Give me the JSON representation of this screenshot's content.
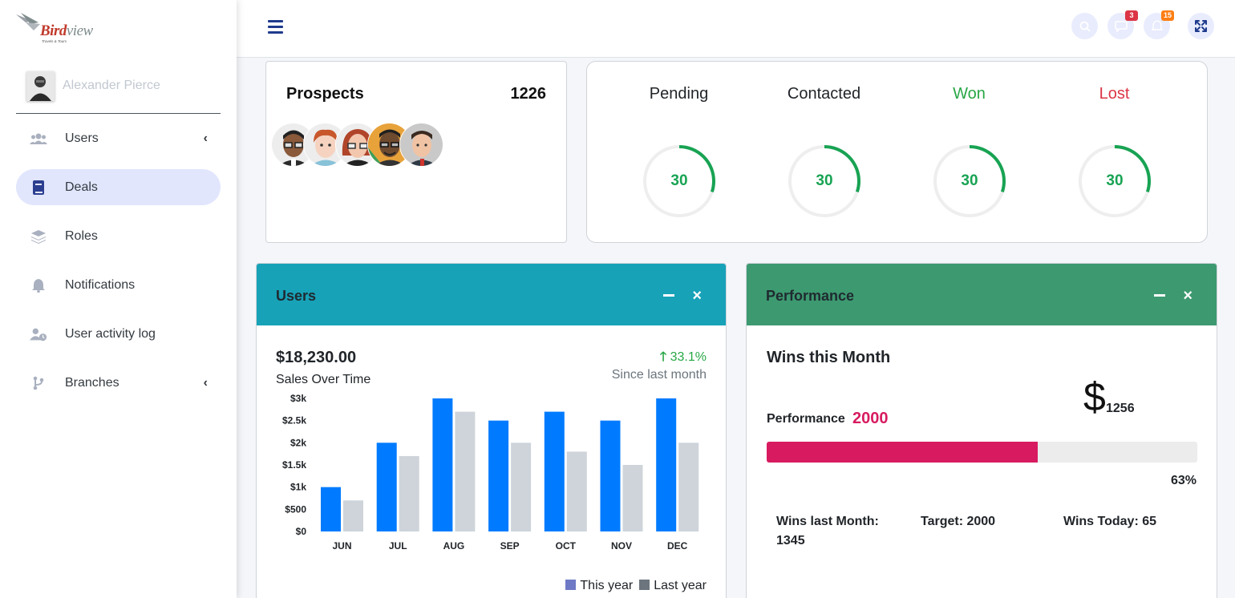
{
  "brand": {
    "name_a": "Bird",
    "name_b": "view",
    "tagline": "Travels & Tours"
  },
  "user": {
    "name": "Alexander Pierce"
  },
  "sidebar": {
    "items": [
      {
        "label": "Users",
        "icon": "users-icon",
        "has_caret": true
      },
      {
        "label": "Deals",
        "icon": "book-icon",
        "active": true
      },
      {
        "label": "Roles",
        "icon": "layers-icon"
      },
      {
        "label": "Notifications",
        "icon": "bell-icon"
      },
      {
        "label": "User activity log",
        "icon": "user-clock-icon"
      },
      {
        "label": "Branches",
        "icon": "branch-icon",
        "has_caret": true
      }
    ],
    "caret": "‹"
  },
  "topbar": {
    "menu_icon": "hamburger-icon",
    "messages_badge": "3",
    "notifications_badge": "15",
    "colors": {
      "messages_badge": "#dc3545",
      "notifications_badge": "#fd7e14"
    }
  },
  "prospects": {
    "title": "Prospects",
    "count": "1226"
  },
  "status": [
    {
      "label": "Pending",
      "value": "30",
      "color": "#212529",
      "fraction": 0.3
    },
    {
      "label": "Contacted",
      "value": "30",
      "color": "#212529",
      "fraction": 0.3
    },
    {
      "label": "Won",
      "value": "30",
      "color": "#28a745",
      "fraction": 0.3
    },
    {
      "label": "Lost",
      "value": "30",
      "color": "#dc3545",
      "fraction": 0.3
    }
  ],
  "users_panel": {
    "title": "Users",
    "header_color": "#17a2b8",
    "amount": "$18,230.00",
    "subtitle": "Sales Over Time",
    "change": "33.1%",
    "since": "Since last month",
    "legend_this": "This year",
    "legend_last": "Last year"
  },
  "chart_data": {
    "type": "bar",
    "categories": [
      "JUN",
      "JUL",
      "AUG",
      "SEP",
      "OCT",
      "NOV",
      "DEC"
    ],
    "series": [
      {
        "name": "This year",
        "color": "#007bff",
        "values": [
          1000,
          2000,
          3000,
          2500,
          2700,
          2500,
          3000
        ]
      },
      {
        "name": "Last year",
        "color": "#ced4da",
        "values": [
          700,
          1700,
          2700,
          2000,
          1800,
          1500,
          2000
        ]
      }
    ],
    "y_ticks": [
      "$0",
      "$500",
      "$1k",
      "$1.5k",
      "$2k",
      "$2.5k",
      "$3k"
    ],
    "ylim": [
      0,
      3000
    ],
    "legend_colors": {
      "this_year": "#6f7ac6",
      "last_year": "#6c757d"
    }
  },
  "performance_panel": {
    "title": "Performance",
    "header_color": "#3d9970",
    "wins_title": "Wins this Month",
    "perf_label": "Performance",
    "perf_value": "2000",
    "dollar_sign": "$",
    "dollar_amount": "1256",
    "progress_percent": 63,
    "progress_text": "63%",
    "wins_last_month": "Wins last Month:",
    "wins_last_month_value": "1345",
    "target": "Target: 2000",
    "wins_today": "Wins Today: 65"
  }
}
